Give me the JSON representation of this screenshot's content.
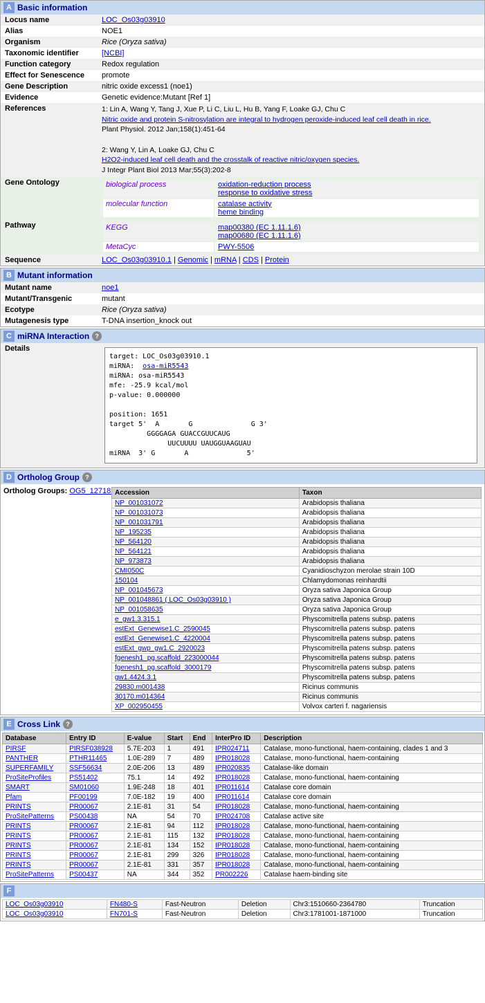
{
  "sections": {
    "A": {
      "label": "A",
      "title": "Basic information",
      "fields": {
        "locus_name_label": "Locus name",
        "locus_name_value": "LOC_Os03g03910",
        "alias_label": "Alias",
        "alias_value": "NOE1",
        "organism_label": "Organism",
        "organism_value": "Rice (Oryza sativa)",
        "taxon_label": "Taxonomic identifier",
        "taxon_value": "[NCBI]",
        "function_label": "Function category",
        "function_value": "Redox regulation",
        "effect_label": "Effect for Senescence",
        "effect_value": "promote",
        "gene_desc_label": "Gene Description",
        "gene_desc_value": "nitric oxide excess1 (noe1)",
        "evidence_label": "Evidence",
        "evidence_value": "Genetic evidence:Mutant [Ref 1]",
        "references_label": "References",
        "ref1_prefix": "1: Lin A, Wang Y, Tang J, Xue P, Li C, Liu L, Hu B, Yang F, Loake GJ, Chu C",
        "ref1_link_text": "Nitric oxide and protein S-nitrosylation are integral to hydrogen peroxide-induced leaf cell death in rice.",
        "ref1_journal": "Plant Physiol. 2012 Jan;158(1):451-64",
        "ref2_prefix": "2: Wang Y, Lin A, Loake GJ, Chu C",
        "ref2_link_text": "H2O2-induced leaf cell death and the crosstalk of reactive nitric/oxygen species.",
        "ref2_journal": "J Integr Plant Biol 2013 Mar;55(3):202-8",
        "go_label": "Gene Ontology",
        "go_bio_label": "biological process",
        "go_bio_values": [
          "oxidation-reduction process",
          "response to oxidative stress"
        ],
        "go_mol_label": "molecular function",
        "go_mol_values": [
          "catalase activity",
          "heme binding"
        ],
        "pathway_label": "Pathway",
        "pathway_kegg_label": "KEGG",
        "pathway_kegg_values": [
          "map00380 (EC 1.11.1.6)",
          "map00680 (EC 1.11.1.6)"
        ],
        "pathway_metacyc_label": "MetaCyc",
        "pathway_metacyc_value": "PWY-5506",
        "sequence_label": "Sequence",
        "sequence_locus": "LOC_Os03g03910.1",
        "sequence_links": [
          "Genomic",
          "mRNA",
          "CDS",
          "Protein"
        ]
      }
    },
    "B": {
      "label": "B",
      "title": "Mutant information",
      "fields": {
        "mutant_name_label": "Mutant name",
        "mutant_name_value": "noe1",
        "mutant_transgenic_label": "Mutant/Transgenic",
        "mutant_transgenic_value": "mutant",
        "ecotype_label": "Ecotype",
        "ecotype_value": "Rice (Oryza sativa)",
        "mutagenesis_label": "Mutagenesis type",
        "mutagenesis_value": "T-DNA insertion_knock out"
      }
    },
    "C": {
      "label": "C",
      "title": "miRNA Interaction",
      "details_label": "Details",
      "mirna_content": "target: LOC_Os03g03910.1\nmiRNA:  osa-miR5543\nmiRNA: osa-miR5543\nmfe: -25.9 kcal/mol\np-value: 0.000000\n\nposition: 1651\ntarget 5'  A       G              G 3'\n         GGGGAGA GUACCGUUCAUG\n              UUCUUUU UAUGGUAAGUAU\nmiRNA  3' G       A              5'"
    },
    "D": {
      "label": "D",
      "title": "Ortholog Group",
      "ortholog_groups_label": "Ortholog Groups:",
      "ortholog_group_id": "OG5_127182",
      "table_headers": [
        "Accession",
        "Taxon"
      ],
      "table_rows": [
        {
          "accession": "NP_001031072",
          "taxon": "Arabidopsis thaliana"
        },
        {
          "accession": "NP_001031073",
          "taxon": "Arabidopsis thaliana"
        },
        {
          "accession": "NP_001031791",
          "taxon": "Arabidopsis thaliana"
        },
        {
          "accession": "NP_195235",
          "taxon": "Arabidopsis thaliana"
        },
        {
          "accession": "NP_564120",
          "taxon": "Arabidopsis thaliana"
        },
        {
          "accession": "NP_564121",
          "taxon": "Arabidopsis thaliana"
        },
        {
          "accession": "NP_973873",
          "taxon": "Arabidopsis thaliana"
        },
        {
          "accession": "CMI050C",
          "taxon": "Cyanidioschyzon merolae strain 10D"
        },
        {
          "accession": "150104",
          "taxon": "Chlamydomonas reinhardtii"
        },
        {
          "accession": "NP_001045673",
          "taxon": "Oryza sativa Japonica Group"
        },
        {
          "accession": "NP_001048861 ( LOC_Os03g03910 )",
          "taxon": "Oryza sativa Japonica Group"
        },
        {
          "accession": "NP_001058635",
          "taxon": "Oryza sativa Japonica Group"
        },
        {
          "accession": "e_gw1.3.315.1",
          "taxon": "Physcomitrella patens subsp. patens"
        },
        {
          "accession": "estExt_Genewise1.C_2590045",
          "taxon": "Physcomitrella patens subsp. patens"
        },
        {
          "accession": "estExt_Genewise1.C_4220004",
          "taxon": "Physcomitrella patens subsp. patens"
        },
        {
          "accession": "estExt_gwp_gw1.C_2920023",
          "taxon": "Physcomitrella patens subsp. patens"
        },
        {
          "accession": "fgenesh1_pg.scaffold_223000044",
          "taxon": "Physcomitrella patens subsp. patens"
        },
        {
          "accession": "fgenesh1_pg.scaffold_3000179",
          "taxon": "Physcomitrella patens subsp. patens"
        },
        {
          "accession": "gw1.4424.3.1",
          "taxon": "Physcomitrella patens subsp. patens"
        },
        {
          "accession": "29830.m001438",
          "taxon": "Ricinus communis"
        },
        {
          "accession": "30170.m014364",
          "taxon": "Ricinus communis"
        },
        {
          "accession": "XP_002950455",
          "taxon": "Volvox carteri f. nagariensis"
        }
      ]
    },
    "E": {
      "label": "E",
      "title": "Cross Link",
      "table_headers": [
        "Database",
        "Entry ID",
        "E-value",
        "Start",
        "End",
        "InterPro ID",
        "Description"
      ],
      "table_rows": [
        {
          "db": "PIRSF",
          "entry": "PIRSF038928",
          "evalue": "5.7E-203",
          "start": "1",
          "end": "491",
          "interpro": "IPR024711",
          "desc": "Catalase, mono-functional, haem-containing, clades 1 and 3"
        },
        {
          "db": "PANTHER",
          "entry": "PTHR11465",
          "evalue": "1.0E-289",
          "start": "7",
          "end": "489",
          "interpro": "IPR018028",
          "desc": "Catalase, mono-functional, haem-containing"
        },
        {
          "db": "SUPERFAMILY",
          "entry": "SSF56634",
          "evalue": "2.0E-206",
          "start": "13",
          "end": "489",
          "interpro": "IPR020835",
          "desc": "Catalase-like domain"
        },
        {
          "db": "ProSiteProfiles",
          "entry": "PS51402",
          "evalue": "75.1",
          "start": "14",
          "end": "492",
          "interpro": "IPR018028",
          "desc": "Catalase, mono-functional, haem-containing"
        },
        {
          "db": "SMART",
          "entry": "SM01060",
          "evalue": "1.9E-248",
          "start": "18",
          "end": "401",
          "interpro": "IPR011614",
          "desc": "Catalase core domain"
        },
        {
          "db": "Pfam",
          "entry": "PF00199",
          "evalue": "7.0E-182",
          "start": "19",
          "end": "400",
          "interpro": "IPR011614",
          "desc": "Catalase core domain"
        },
        {
          "db": "PRINTS",
          "entry": "PR00067",
          "evalue": "2.1E-81",
          "start": "31",
          "end": "54",
          "interpro": "IPR018028",
          "desc": "Catalase, mono-functional, haem-containing"
        },
        {
          "db": "ProSitePatterns",
          "entry": "PS00438",
          "evalue": "NA",
          "start": "54",
          "end": "70",
          "interpro": "IPR024708",
          "desc": "Catalase active site"
        },
        {
          "db": "PRINTS",
          "entry": "PR00067",
          "evalue": "2.1E-81",
          "start": "94",
          "end": "112",
          "interpro": "IPR018028",
          "desc": "Catalase, mono-functional, haem-containing"
        },
        {
          "db": "PRINTS",
          "entry": "PR00067",
          "evalue": "2.1E-81",
          "start": "115",
          "end": "132",
          "interpro": "IPR018028",
          "desc": "Catalase, mono-functional, haem-containing"
        },
        {
          "db": "PRINTS",
          "entry": "PR00067",
          "evalue": "2.1E-81",
          "start": "134",
          "end": "152",
          "interpro": "IPR018028",
          "desc": "Catalase, mono-functional, haem-containing"
        },
        {
          "db": "PRINTS",
          "entry": "PR00067",
          "evalue": "2.1E-81",
          "start": "299",
          "end": "326",
          "interpro": "IPR018028",
          "desc": "Catalase, mono-functional, haem-containing"
        },
        {
          "db": "PRINTS",
          "entry": "PR00067",
          "evalue": "2.1E-81",
          "start": "331",
          "end": "357",
          "interpro": "IPR018028",
          "desc": "Catalase, mono-functional, haem-containing"
        },
        {
          "db": "ProSitePatterns",
          "entry": "PS00437",
          "evalue": "NA",
          "start": "344",
          "end": "352",
          "interpro": "PR002226",
          "desc": "Catalase haem-binding site"
        }
      ]
    },
    "F": {
      "label": "F",
      "rows": [
        {
          "col1": "LOC_Os03g03910",
          "col2": "FN480-S",
          "col3": "Fast-Neutron",
          "col4": "Deletion",
          "col5": "Chr3:1510660-2364780",
          "col6": "Truncation"
        },
        {
          "col1": "LOC_Os03g03910",
          "col2": "FN701-S",
          "col3": "Fast-Neutron",
          "col4": "Deletion",
          "col5": "Chr3:1781001-1871000",
          "col6": "Truncation"
        }
      ]
    }
  }
}
